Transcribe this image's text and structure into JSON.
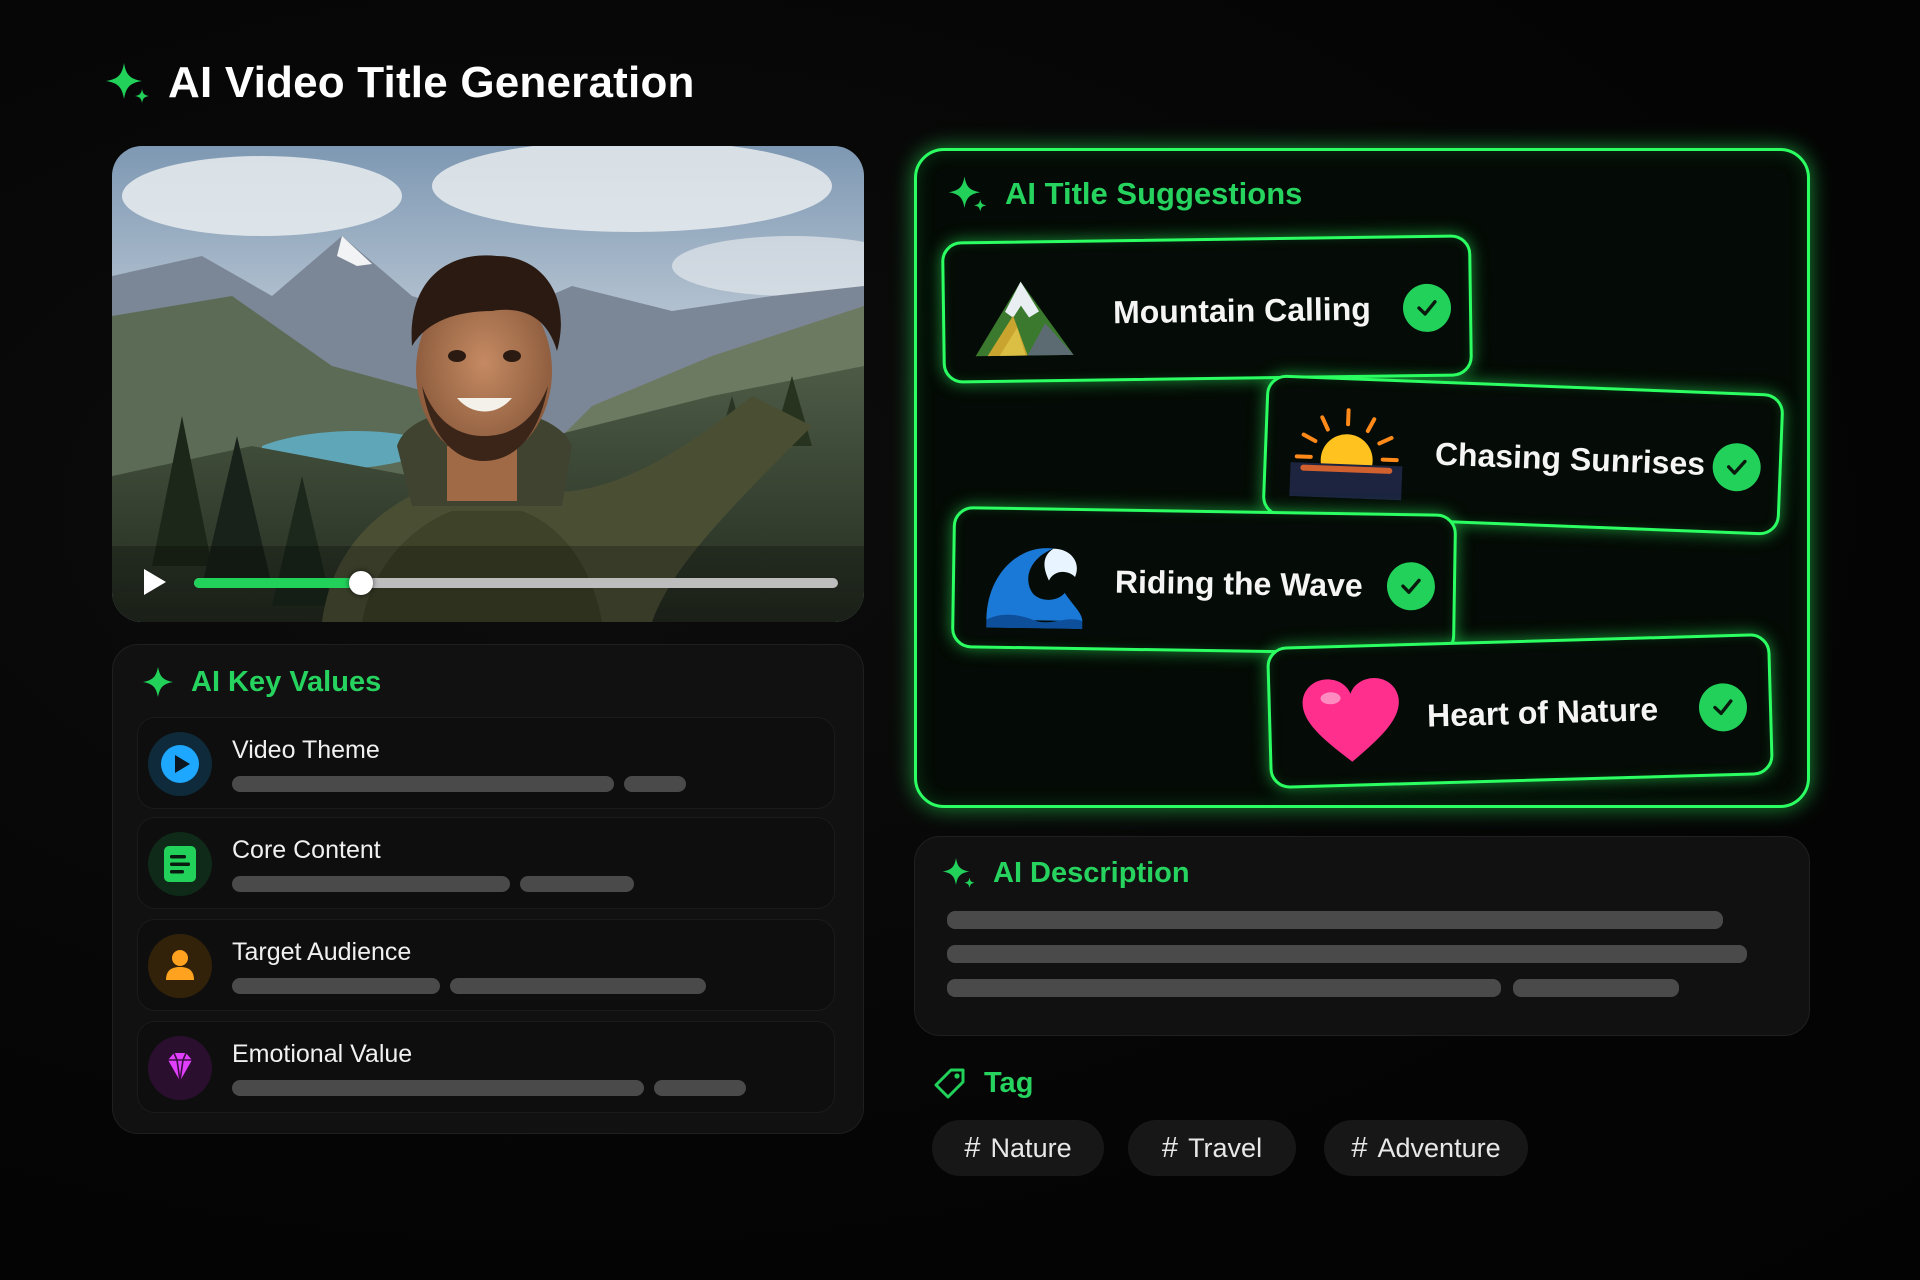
{
  "header": {
    "title": "AI Video Title Generation",
    "icon": "sparkle-icon"
  },
  "video": {
    "progress": 0.26,
    "play_icon": "play-icon"
  },
  "key_values": {
    "title": "AI Key Values",
    "items": [
      {
        "label": "Video Theme",
        "icon": "play-circle-icon",
        "color": "#1ea7ff"
      },
      {
        "label": "Core Content",
        "icon": "document-icon",
        "color": "#22d15a"
      },
      {
        "label": "Target Audience",
        "icon": "person-icon",
        "color": "#ffa21f"
      },
      {
        "label": "Emotional Value",
        "icon": "diamond-icon",
        "color": "#e040fb"
      }
    ]
  },
  "suggestions": {
    "title": "AI Title Suggestions",
    "items": [
      {
        "title": "Mountain Calling",
        "icon": "mountain-icon",
        "selected": true
      },
      {
        "title": "Chasing Sunrises",
        "icon": "sunrise-icon",
        "selected": true
      },
      {
        "title": "Riding the Wave",
        "icon": "wave-icon",
        "selected": true
      },
      {
        "title": "Heart of Nature",
        "icon": "heart-icon",
        "selected": true
      }
    ]
  },
  "description": {
    "title": "AI Description"
  },
  "tags": {
    "title": "Tag",
    "items": [
      {
        "hash": "#",
        "label": "Nature"
      },
      {
        "hash": "#",
        "label": "Travel"
      },
      {
        "hash": "#",
        "label": "Adventure"
      }
    ]
  },
  "colors": {
    "accent": "#22d15a",
    "glow": "#2bff62",
    "background": "#050505"
  }
}
